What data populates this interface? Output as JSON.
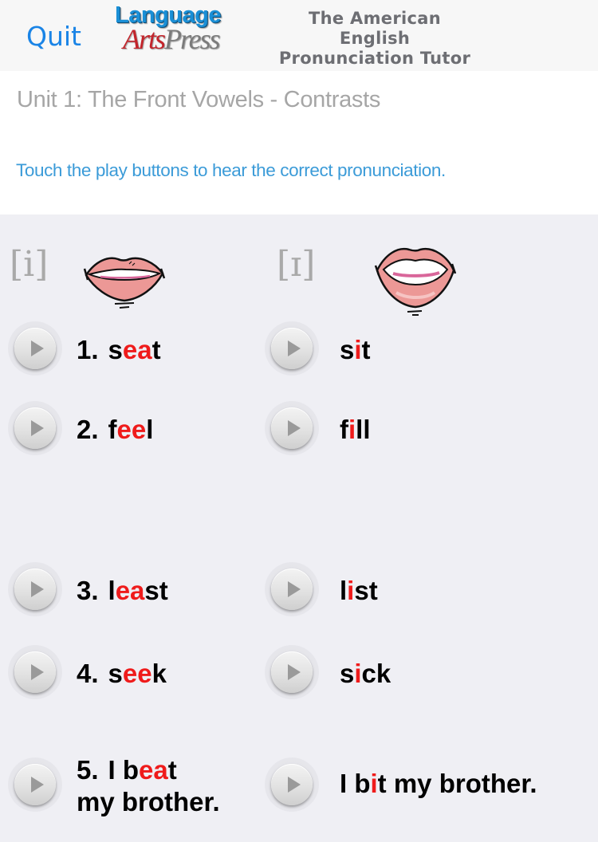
{
  "header": {
    "quit_label": "Quit",
    "logo": {
      "top": "Language",
      "arts": "Arts",
      "press": "Press"
    },
    "title_line1": "The American English",
    "title_line2": "Pronunciation Tutor"
  },
  "intro": {
    "unit_title": "Unit 1: The Front Vowels - Contrasts",
    "instructions": "Touch the play buttons to hear the correct pronunciation."
  },
  "colors": {
    "accent_blue": "#1a84e6",
    "instruction_blue": "#3b9bd8",
    "highlight_red": "#ef1b1b",
    "content_bg": "#efeff4"
  },
  "columns": [
    {
      "phoneme": "[i]",
      "lips_icon": "lips-smile-icon"
    },
    {
      "phoneme": "[ɪ]",
      "lips_icon": "lips-relaxed-icon"
    }
  ],
  "rows": [
    {
      "number": "1.",
      "left": {
        "pre": "s",
        "hl": "ea",
        "post": "t"
      },
      "right": {
        "pre": "s",
        "hl": "i",
        "post": "t"
      }
    },
    {
      "number": "2.",
      "left": {
        "pre": "f",
        "hl": "ee",
        "post": "l"
      },
      "right": {
        "pre": "f",
        "hl": "i",
        "post": "ll"
      }
    },
    {
      "number": "3.",
      "left": {
        "pre": "l",
        "hl": "ea",
        "post": "st"
      },
      "right": {
        "pre": "l",
        "hl": "i",
        "post": "st"
      }
    },
    {
      "number": "4.",
      "left": {
        "pre": "s",
        "hl": "ee",
        "post": "k"
      },
      "right": {
        "pre": "s",
        "hl": "i",
        "post": "ck"
      }
    },
    {
      "number": "5.",
      "left": {
        "pre": "I b",
        "hl": "ea",
        "post": "t",
        "line2": "my brother."
      },
      "right": {
        "pre": "I b",
        "hl": "i",
        "post": "t my brother."
      }
    }
  ]
}
